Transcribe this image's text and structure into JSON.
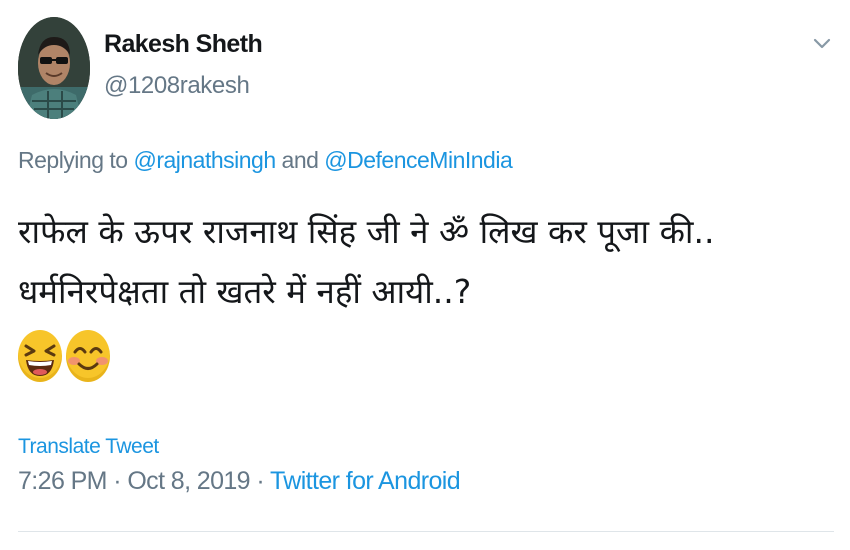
{
  "user": {
    "display_name": "Rakesh Sheth",
    "handle": "@1208rakesh"
  },
  "reply": {
    "prefix": "Replying to ",
    "mention_1": "@rajnathsingh",
    "joiner": " and ",
    "mention_2": "@DefenceMinIndia"
  },
  "tweet": {
    "line_1": "राफेल के ऊपर राजनाथ सिंह जी ने ॐ लिख कर पूजा की..",
    "line_2": "धर्मनिरपेक्षता तो खतरे में नहीं आयी..?",
    "emojis": [
      "grinning-squinting-face",
      "smiling-face-with-smiling-eyes"
    ]
  },
  "translate_label": "Translate Tweet",
  "meta": {
    "time": "7:26 PM",
    "separator_1": " · ",
    "date": "Oct 8, 2019",
    "separator_2": " · ",
    "source": "Twitter for Android"
  },
  "colors": {
    "link": "#1b95e0",
    "secondary_text": "#657786",
    "primary_text": "#14171a"
  }
}
